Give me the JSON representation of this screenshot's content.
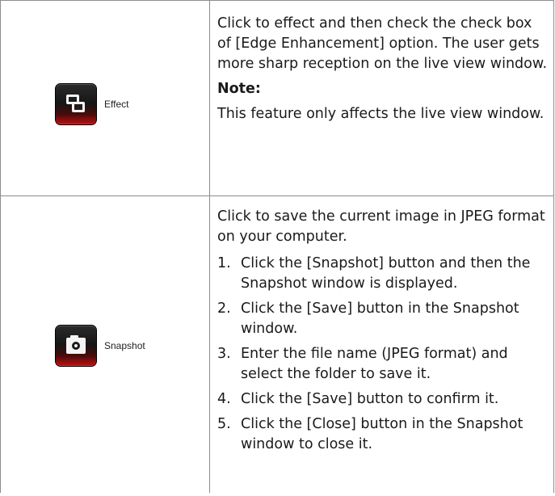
{
  "effect_row": {
    "button_label": "Effect",
    "icon": "overlap-windows-icon",
    "description": "Click to effect and then check the check box of [Edge Enhancement] option. The user gets more sharp reception on the live view window.",
    "note_label": "Note:",
    "note_text": "This feature only affects the live view window."
  },
  "snapshot_row": {
    "button_label": "Snapshot",
    "icon": "camera-icon",
    "description": "Click to save the current image in JPEG format on your computer.",
    "steps": [
      {
        "num": "1.",
        "text": "Click the [Snapshot] button and then the Snapshot window is displayed."
      },
      {
        "num": "2.",
        "text": "Click the [Save] button in the Snapshot window."
      },
      {
        "num": "3.",
        "text": "Enter the file name (JPEG format) and select the folder to save it."
      },
      {
        "num": "4.",
        "text": "Click the [Save] button to confirm it."
      },
      {
        "num": "5.",
        "text": "Click the [Close] button in the Snapshot window to close it."
      }
    ]
  },
  "colors": {
    "border": "#8c8c8c",
    "icon_top": "#2b2b2b",
    "icon_bottom": "#c01010",
    "icon_glyph": "#f4f4f4"
  }
}
